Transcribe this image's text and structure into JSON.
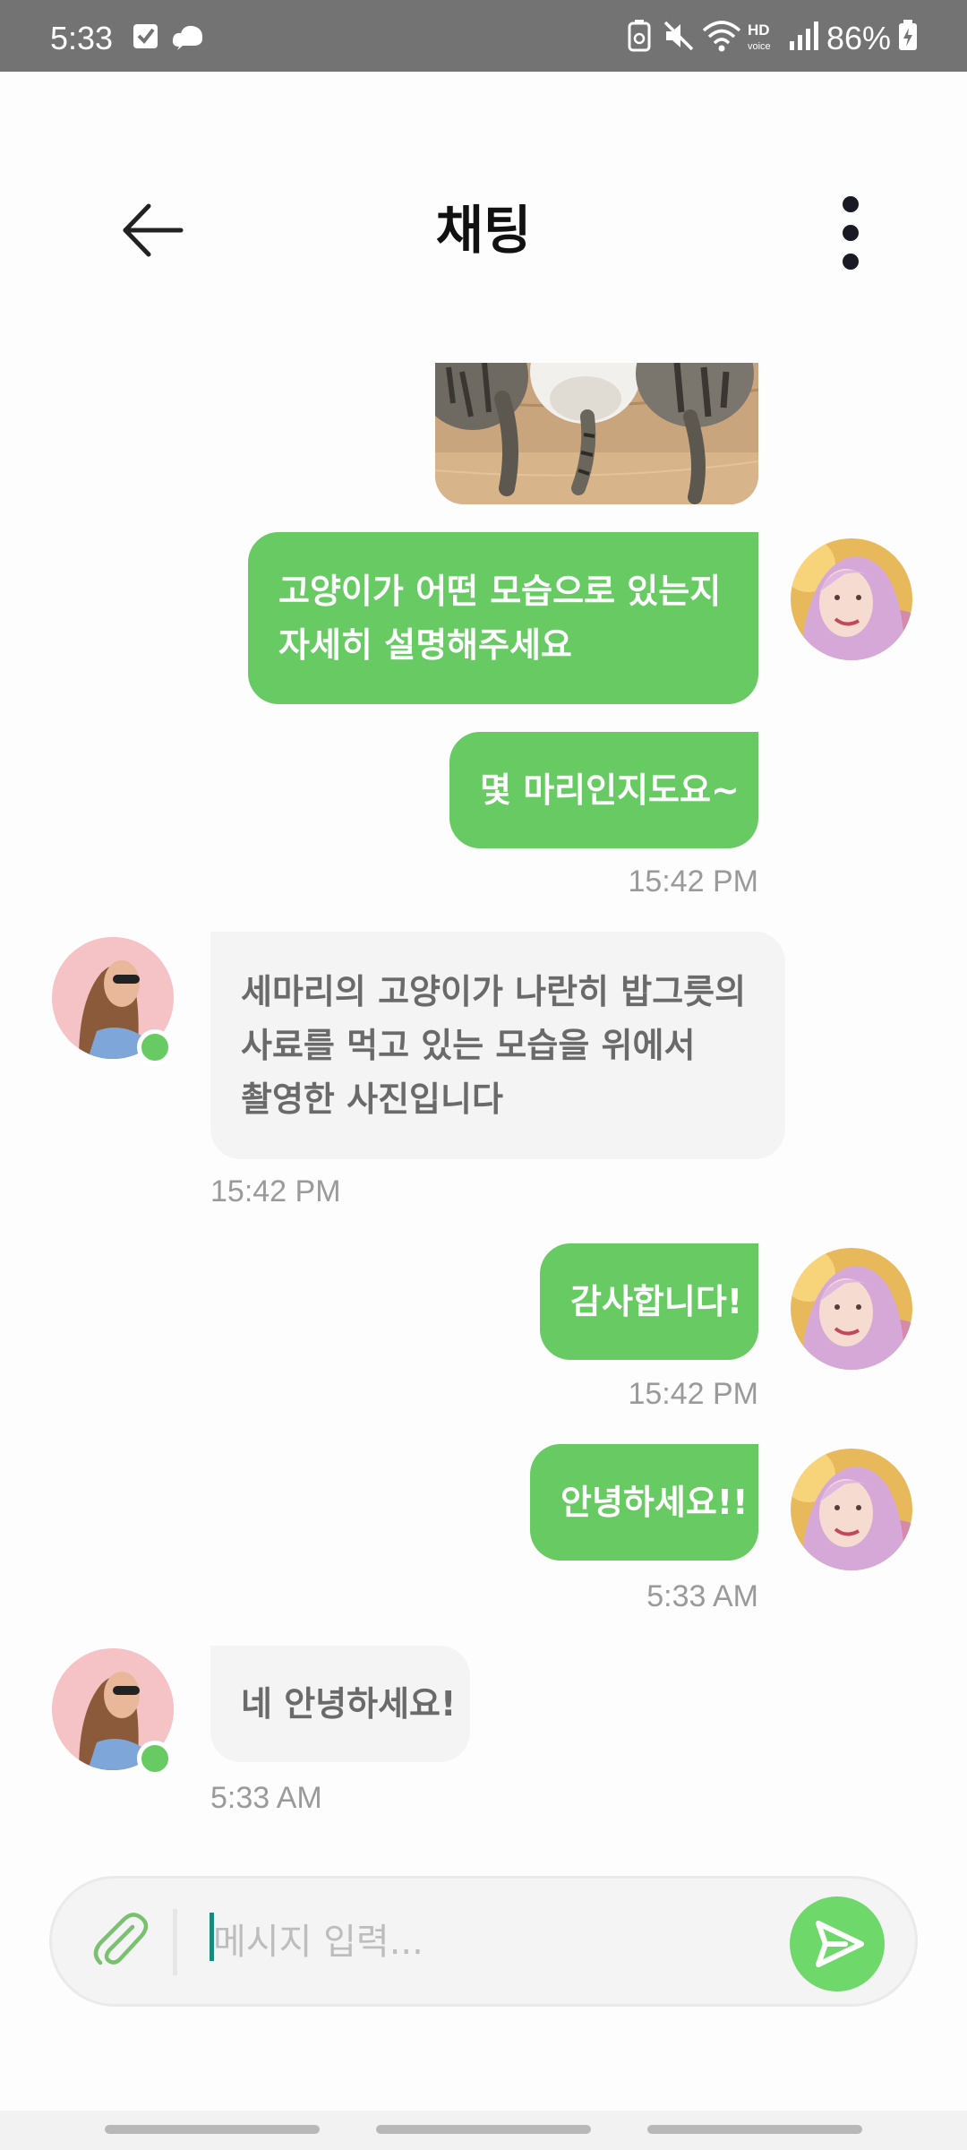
{
  "status_bar": {
    "time": "5:33",
    "battery_percent": "86%",
    "icons": [
      "check-icon",
      "cloud-icon",
      "recycle-icon",
      "mute-icon",
      "wifi-icon",
      "hd-voice-icon",
      "signal-icon",
      "battery-charging-icon"
    ]
  },
  "header": {
    "title": "채팅",
    "back_icon": "arrow-left-icon",
    "more_icon": "more-vertical-icon"
  },
  "messages": [
    {
      "side": "out",
      "type": "image"
    },
    {
      "side": "out",
      "lines": [
        "고양이가 어떤 모습으로 있는지",
        "자세히 설명해주세요"
      ]
    },
    {
      "side": "out",
      "lines": [
        "몇 마리인지도요~"
      ],
      "time": "15:42 PM"
    },
    {
      "side": "in",
      "lines": [
        "세마리의 고양이가 나란히 밥그릇의",
        "사료를 먹고 있는 모습을 위에서",
        "촬영한 사진입니다"
      ],
      "time": "15:42 PM"
    },
    {
      "side": "out",
      "lines": [
        "감사합니다!"
      ],
      "time": "15:42 PM"
    },
    {
      "side": "out",
      "lines": [
        "안녕하세요!!"
      ],
      "time": "5:33 AM"
    },
    {
      "side": "in",
      "lines": [
        "네 안녕하세요!"
      ],
      "time": "5:33 AM"
    }
  ],
  "input": {
    "placeholder": "메시지 입력...",
    "value": "",
    "attach_icon": "paperclip-icon",
    "send_icon": "send-icon"
  },
  "colors": {
    "outgoing_bubble": "#68CA63",
    "incoming_bubble": "#F4F4F5",
    "online_indicator": "#68CA63",
    "send_button": "#6FD86B"
  }
}
